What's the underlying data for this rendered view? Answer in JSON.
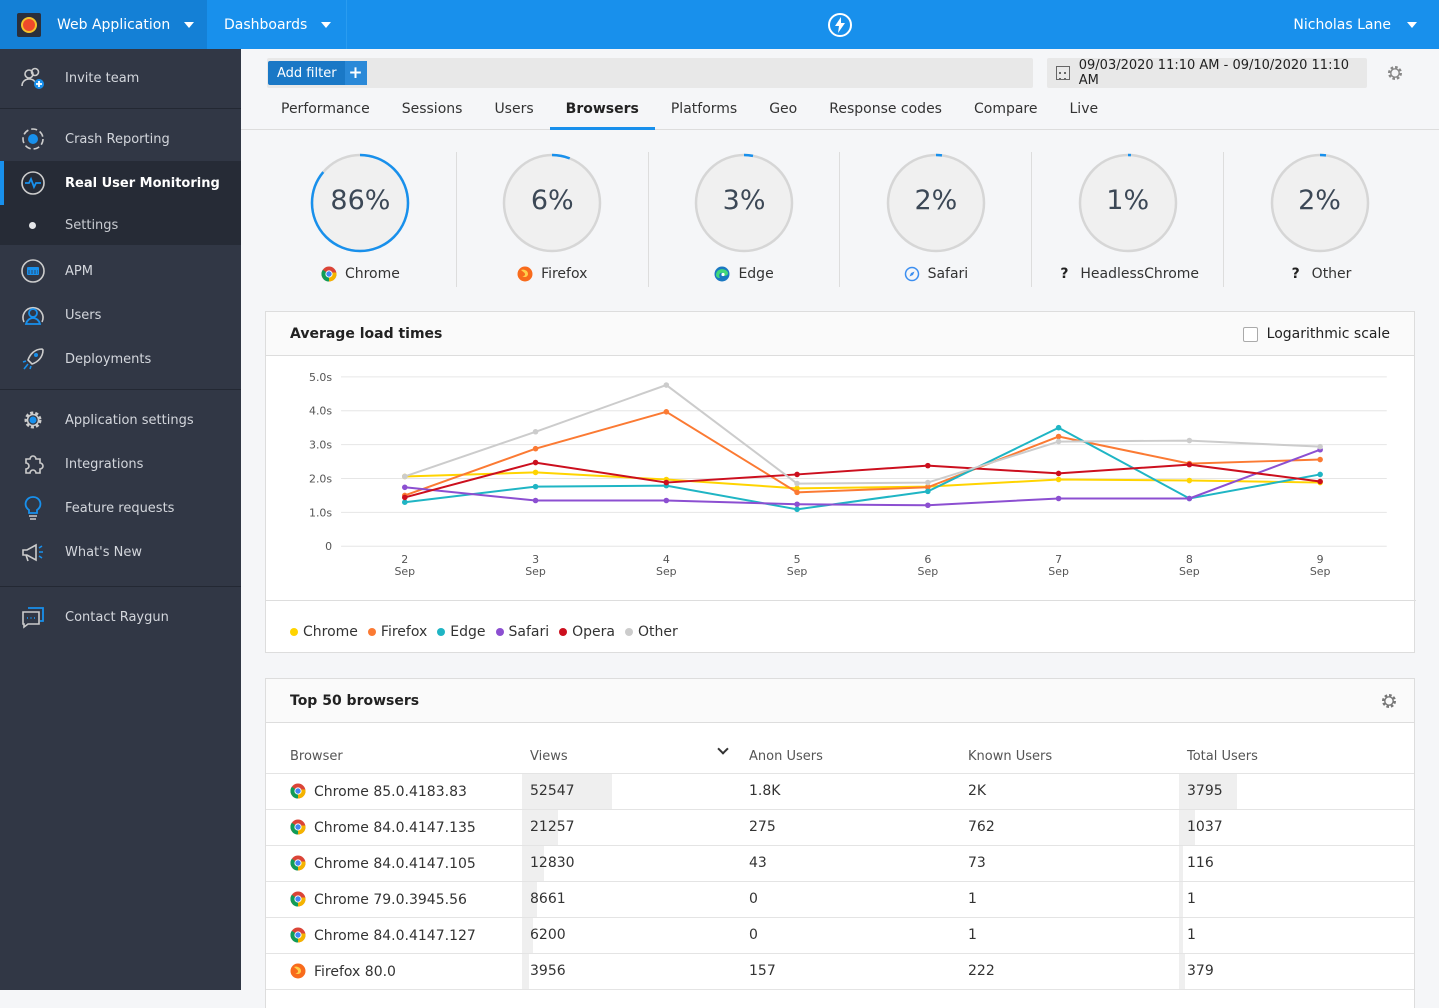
{
  "topbar": {
    "app_name": "Web Application",
    "dashboards_label": "Dashboards",
    "user_name": "Nicholas Lane"
  },
  "sidebar": {
    "items": [
      {
        "label": "Invite team",
        "icon": "invite-team-icon"
      },
      {
        "label": "Crash Reporting",
        "icon": "crash-reporting-icon"
      },
      {
        "label": "Real User Monitoring",
        "icon": "rum-pulse-icon",
        "active": true
      },
      {
        "label": "Settings",
        "icon": "dot-icon",
        "sub": true
      },
      {
        "label": "APM",
        "icon": "apm-icon"
      },
      {
        "label": "Users",
        "icon": "users-icon"
      },
      {
        "label": "Deployments",
        "icon": "rocket-icon"
      },
      {
        "label": "Application settings",
        "icon": "gear-icon"
      },
      {
        "label": "Integrations",
        "icon": "puzzle-icon"
      },
      {
        "label": "Feature requests",
        "icon": "lightbulb-icon"
      },
      {
        "label": "What's New",
        "icon": "megaphone-icon"
      },
      {
        "label": "Contact Raygun",
        "icon": "chat-icon"
      }
    ]
  },
  "filters": {
    "add_filter_label": "Add filter",
    "plus": "+",
    "date_range": "09/03/2020 11:10 AM - 09/10/2020 11:10 AM"
  },
  "tabs": [
    {
      "label": "Performance"
    },
    {
      "label": "Sessions"
    },
    {
      "label": "Users"
    },
    {
      "label": "Browsers",
      "active": true
    },
    {
      "label": "Platforms"
    },
    {
      "label": "Geo"
    },
    {
      "label": "Response codes"
    },
    {
      "label": "Compare"
    },
    {
      "label": "Live"
    }
  ],
  "gauges": [
    {
      "label": "Chrome",
      "pct_text": "86%",
      "value": 0.86,
      "icon": "chrome-icon"
    },
    {
      "label": "Firefox",
      "pct_text": "6%",
      "value": 0.06,
      "icon": "firefox-icon"
    },
    {
      "label": "Edge",
      "pct_text": "3%",
      "value": 0.03,
      "icon": "edge-icon"
    },
    {
      "label": "Safari",
      "pct_text": "2%",
      "value": 0.02,
      "icon": "safari-icon"
    },
    {
      "label": "HeadlessChrome",
      "pct_text": "1%",
      "value": 0.01,
      "icon": "unknown-browser-icon"
    },
    {
      "label": "Other",
      "pct_text": "2%",
      "value": 0.02,
      "icon": "unknown-browser-icon"
    }
  ],
  "load_panel": {
    "title": "Average load times",
    "log_scale_label": "Logarithmic scale",
    "log_scale_checked": false
  },
  "chart_data": {
    "type": "line",
    "title": "Average load times",
    "xlabel": "",
    "ylabel": "",
    "x": [
      "2",
      "3",
      "4",
      "5",
      "6",
      "7",
      "8",
      "9"
    ],
    "x_sublabel": "Sep",
    "ylim": [
      0,
      5
    ],
    "yticks": [
      0,
      1,
      2,
      3,
      4,
      5
    ],
    "ytick_labels": [
      "0",
      "1.0s",
      "2.0s",
      "3.0s",
      "4.0s",
      "5.0s"
    ],
    "grid": true,
    "legend_position": "bottom-left",
    "series": [
      {
        "name": "Chrome",
        "color": "#ffd400",
        "values": [
          2.06,
          2.18,
          1.97,
          1.71,
          1.76,
          1.97,
          1.94,
          1.88
        ]
      },
      {
        "name": "Firefox",
        "color": "#fb7a33",
        "values": [
          1.5,
          2.88,
          3.97,
          1.59,
          1.74,
          3.24,
          2.44,
          2.56
        ]
      },
      {
        "name": "Edge",
        "color": "#1fb5c4",
        "values": [
          1.3,
          1.76,
          1.79,
          1.09,
          1.62,
          3.5,
          1.41,
          2.12
        ]
      },
      {
        "name": "Safari",
        "color": "#8c4fd1",
        "values": [
          1.74,
          1.35,
          1.35,
          1.24,
          1.21,
          1.41,
          1.41,
          2.85
        ]
      },
      {
        "name": "Opera",
        "color": "#cc0f1e",
        "values": [
          1.44,
          2.47,
          1.88,
          2.12,
          2.38,
          2.15,
          2.41,
          1.91
        ]
      },
      {
        "name": "Other",
        "color": "#cccccc",
        "values": [
          2.06,
          3.38,
          4.76,
          1.85,
          1.88,
          3.09,
          3.12,
          2.94
        ]
      }
    ]
  },
  "browsers_table": {
    "title": "Top 50 browsers",
    "columns": [
      "Browser",
      "Views",
      "Anon Users",
      "Known Users",
      "Total Users"
    ],
    "sorted_column": "Views",
    "rows": [
      {
        "browser": "Chrome 85.0.4183.83",
        "icon": "chrome-icon",
        "views": "52547",
        "anon": "1.8K",
        "known": "2K",
        "total": "3795",
        "views_frac": 1.0,
        "total_frac": 1.0
      },
      {
        "browser": "Chrome 84.0.4147.135",
        "icon": "chrome-icon",
        "views": "21257",
        "anon": "275",
        "known": "762",
        "total": "1037",
        "views_frac": 0.4045,
        "total_frac": 0.2733
      },
      {
        "browser": "Chrome 84.0.4147.105",
        "icon": "chrome-icon",
        "views": "12830",
        "anon": "43",
        "known": "73",
        "total": "116",
        "views_frac": 0.2442,
        "total_frac": 0.0306
      },
      {
        "browser": "Chrome 79.0.3945.56",
        "icon": "chrome-icon",
        "views": "8661",
        "anon": "0",
        "known": "1",
        "total": "1",
        "views_frac": 0.1648,
        "total_frac": 0.0003
      },
      {
        "browser": "Chrome 84.0.4147.127",
        "icon": "chrome-icon",
        "views": "6200",
        "anon": "0",
        "known": "1",
        "total": "1",
        "views_frac": 0.118,
        "total_frac": 0.0003
      },
      {
        "browser": "Firefox 80.0",
        "icon": "firefox-icon",
        "views": "3956",
        "anon": "157",
        "known": "222",
        "total": "379",
        "views_frac": 0.0753,
        "total_frac": 0.0999
      }
    ]
  }
}
